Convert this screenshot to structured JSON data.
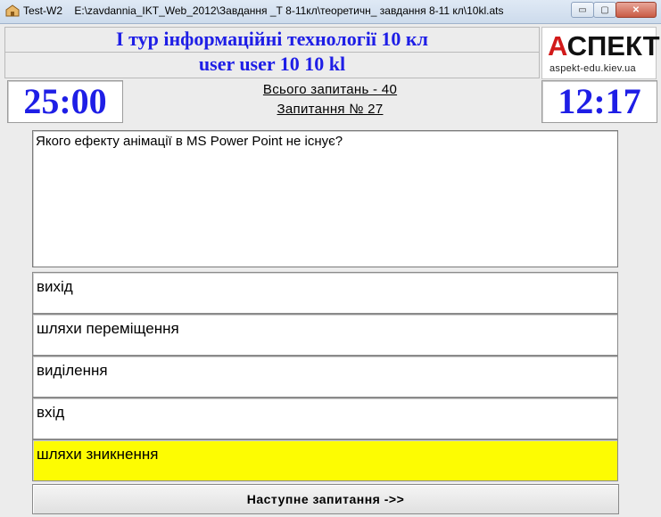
{
  "window": {
    "app_name": "Test-W2",
    "file_path": "E:\\zavdannia_IKT_Web_2012\\Завдання _Т 8-11кл\\теоретичн_ завдання  8-11 кл\\10kl.ats",
    "minimize_label": "▭",
    "maximize_label": "▢",
    "close_label": "✕"
  },
  "header": {
    "title": "І тур інформаційні технології 10 кл",
    "user": "user user 10 10 kl"
  },
  "logo": {
    "part_red": "А",
    "part_black": "СПЕКТ",
    "site": "aspekt-edu.kiev.ua"
  },
  "timers": {
    "total": "25:00",
    "current": "12:17"
  },
  "info": {
    "total_questions": "Всього запитань - 40",
    "question_number": "Запитання № 27"
  },
  "question": {
    "text": "Якого ефекту анімації в MS Power Point не існує?"
  },
  "answers": [
    {
      "label": "вихід",
      "selected": false
    },
    {
      "label": "шляхи переміщення",
      "selected": false
    },
    {
      "label": "виділення",
      "selected": false
    },
    {
      "label": "вхід",
      "selected": false
    },
    {
      "label": "шляхи зникнення",
      "selected": true
    }
  ],
  "next_button": "Наступне запитання ->>",
  "colors": {
    "header_text": "#1e1ee6",
    "selected_answer": "#fdfc02",
    "logo_red": "#d21a1a"
  }
}
